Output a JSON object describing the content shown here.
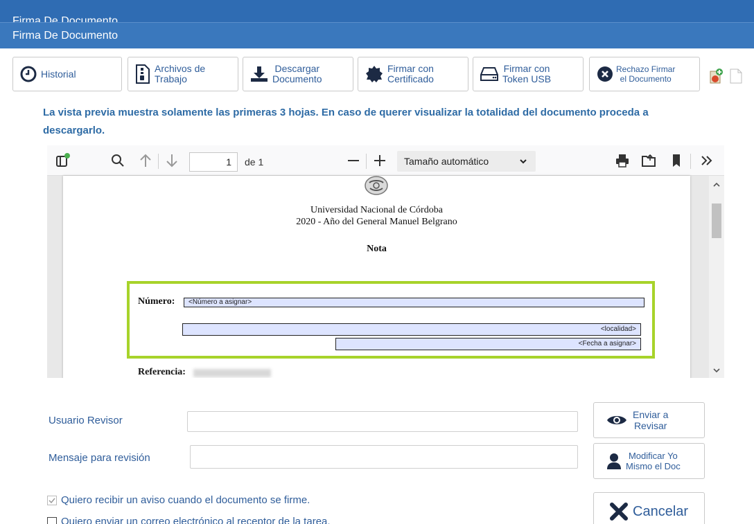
{
  "window": {
    "back_title": "Firma De Documento",
    "title": "Firma De Documento"
  },
  "toolbar": {
    "historial": "Historial",
    "archivos_l1": "Archivos de",
    "archivos_l2": "Trabajo",
    "descargar_l1": "Descargar",
    "descargar_l2": "Documento",
    "firmar_cert_l1": "Firmar con",
    "firmar_cert_l2": "Certificado",
    "firmar_token_l1": "Firmar con",
    "firmar_token_l2": "Token USB",
    "rechazo_l1": "Rechazo Firmar",
    "rechazo_l2": "el Documento"
  },
  "notice": "La vista previa muestra solamente las primeras 3 hojas. En caso de querer visualizar la totalidad del documento proceda a descargarlo.",
  "viewer": {
    "page_number": "1",
    "page_of": "de 1",
    "zoom": "Tamaño automático"
  },
  "document": {
    "university": "Universidad Nacional de Córdoba",
    "year_line": "2020 - Año del General Manuel Belgrano",
    "heading": "Nota",
    "numero_label": "Número:",
    "numero_placeholder": "<Número a asignar>",
    "localidad_placeholder": "<localidad>",
    "fecha_placeholder": "<Fecha a asignar>",
    "referencia_label": "Referencia:"
  },
  "form": {
    "usuario_revisor_label": "Usuario Revisor",
    "usuario_revisor_value": "",
    "mensaje_label": "Mensaje para revisión",
    "mensaje_value": "",
    "enviar_l1": "Enviar a",
    "enviar_l2": "Revisar",
    "modificar_l1": "Modificar Yo",
    "modificar_l2": "Mismo el Doc",
    "cancelar": "Cancelar",
    "check_aviso": "Quiero recibir un aviso cuando el documento se firme.",
    "check_correo": "Quiero enviar un correo electrónico al receptor de la tarea."
  },
  "colors": {
    "title_bar": "#3a78bd",
    "accent_text": "#2f5d9a",
    "highlight_border": "#a7d32a",
    "field_fill": "#dde4ff"
  }
}
